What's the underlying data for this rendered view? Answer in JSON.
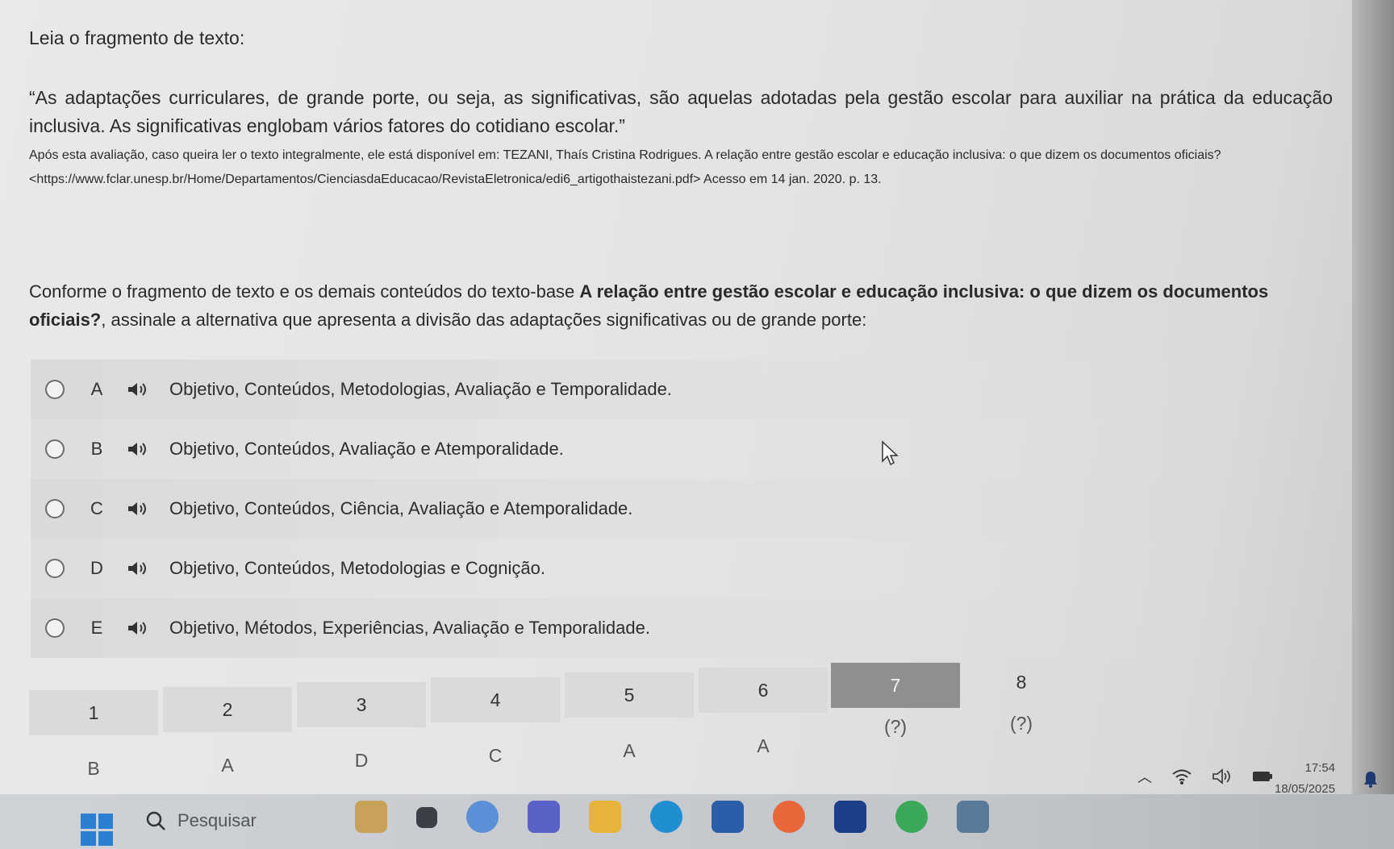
{
  "intro": "Leia o fragmento de texto:",
  "quote": "“As adaptações curriculares, de grande porte, ou seja, as significativas, são aquelas adotadas pela gestão escolar para auxiliar na prática da educação inclusiva. As significativas englobam vários fatores do cotidiano escolar.”",
  "source_line1": "Após esta avaliação, caso queira ler o texto integralmente, ele está disponível em: TEZANI, Thaís Cristina Rodrigues. A relação entre gestão escolar e educação inclusiva: o que dizem os documentos oficiais?",
  "source_line2": "<https://www.fclar.unesp.br/Home/Departamentos/CienciasdaEducacao/RevistaEletronica/edi6_artigothaistezani.pdf> Acesso em 14 jan. 2020. p. 13.",
  "question": {
    "prefix": "Conforme o fragmento de texto e os demais conteúdos do texto-base ",
    "bold": "A relação entre gestão escolar e educação inclusiva: o que dizem os documentos oficiais?",
    "suffix": ", assinale a alternativa que apresenta a divisão das adaptações significativas ou de grande porte:"
  },
  "options": [
    {
      "letter": "A",
      "text": "Objetivo, Conteúdos, Metodologias, Avaliação e Temporalidade."
    },
    {
      "letter": "B",
      "text": "Objetivo, Conteúdos, Avaliação e Atemporalidade."
    },
    {
      "letter": "C",
      "text": "Objetivo, Conteúdos, Ciência, Avaliação e Atemporalidade."
    },
    {
      "letter": "D",
      "text": "Objetivo, Conteúdos, Metodologias e Cognição."
    },
    {
      "letter": "E",
      "text": "Objetivo, Métodos, Experiências, Avaliação e Temporalidade."
    }
  ],
  "answers": [
    {
      "num": "1",
      "val": "B"
    },
    {
      "num": "2",
      "val": "A"
    },
    {
      "num": "3",
      "val": "D"
    },
    {
      "num": "4",
      "val": "C"
    },
    {
      "num": "5",
      "val": "A"
    },
    {
      "num": "6",
      "val": "A"
    },
    {
      "num": "7",
      "val": "(?)"
    },
    {
      "num": "8",
      "val": "(?)"
    }
  ],
  "active_answer_index": 6,
  "taskbar": {
    "search_placeholder": "Pesquisar",
    "time": "17:54",
    "date": "18/05/2025"
  },
  "colors": {
    "windows_blue": "#2b7fd3",
    "active_tab": "#8f8f8f"
  }
}
